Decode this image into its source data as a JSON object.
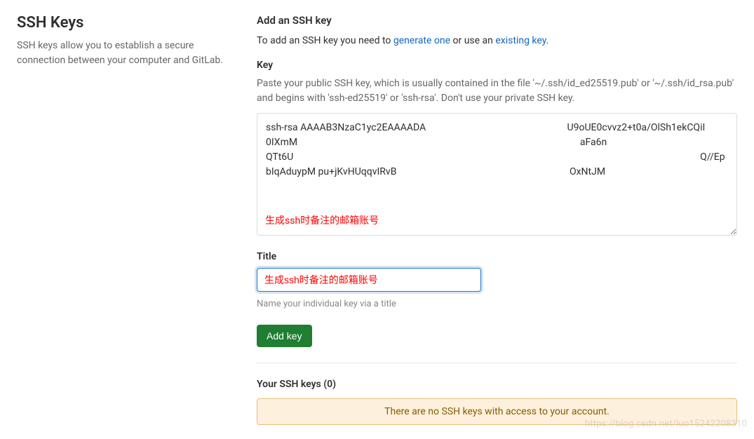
{
  "sidebar": {
    "title": "SSH Keys",
    "description": "SSH keys allow you to establish a secure connection between your computer and GitLab."
  },
  "form": {
    "heading": "Add an SSH key",
    "instruction_prefix": "To add an SSH key you need to ",
    "generate_link": "generate one",
    "instruction_mid": " or use an ",
    "existing_link": "existing key",
    "instruction_suffix": ".",
    "key_label": "Key",
    "key_help": "Paste your public SSH key, which is usually contained in the file '~/.ssh/id_ed25519.pub' or '~/.ssh/id_rsa.pub' and begins with 'ssh-ed25519' or 'ssh-rsa'. Don't use your private SSH key.",
    "key_value": "ssh-rsa AAAAB3NzaC1yc2EAAAADA                                                          U9oUE0cvvz2+t0a/OlSh1ekCQiI                       0IXmM                                                                                                                    aFa6n                                                                                                                                                                                          QTt6U                                                                                                                                                                       Q//EpbIqAduypM pu+jKvHUqqvIRvB                                                                       OxNtJM",
    "key_overlay_note": "生成ssh时备注的邮箱账号",
    "title_label": "Title",
    "title_value": "生成ssh时备注的邮箱账号",
    "title_hint": "Name your individual key via a title",
    "submit_label": "Add key"
  },
  "list": {
    "heading": "Your SSH keys (0)",
    "empty_message": "There are no SSH keys with access to your account."
  },
  "watermark": "https://blog.csdn.net/luo15242208310"
}
